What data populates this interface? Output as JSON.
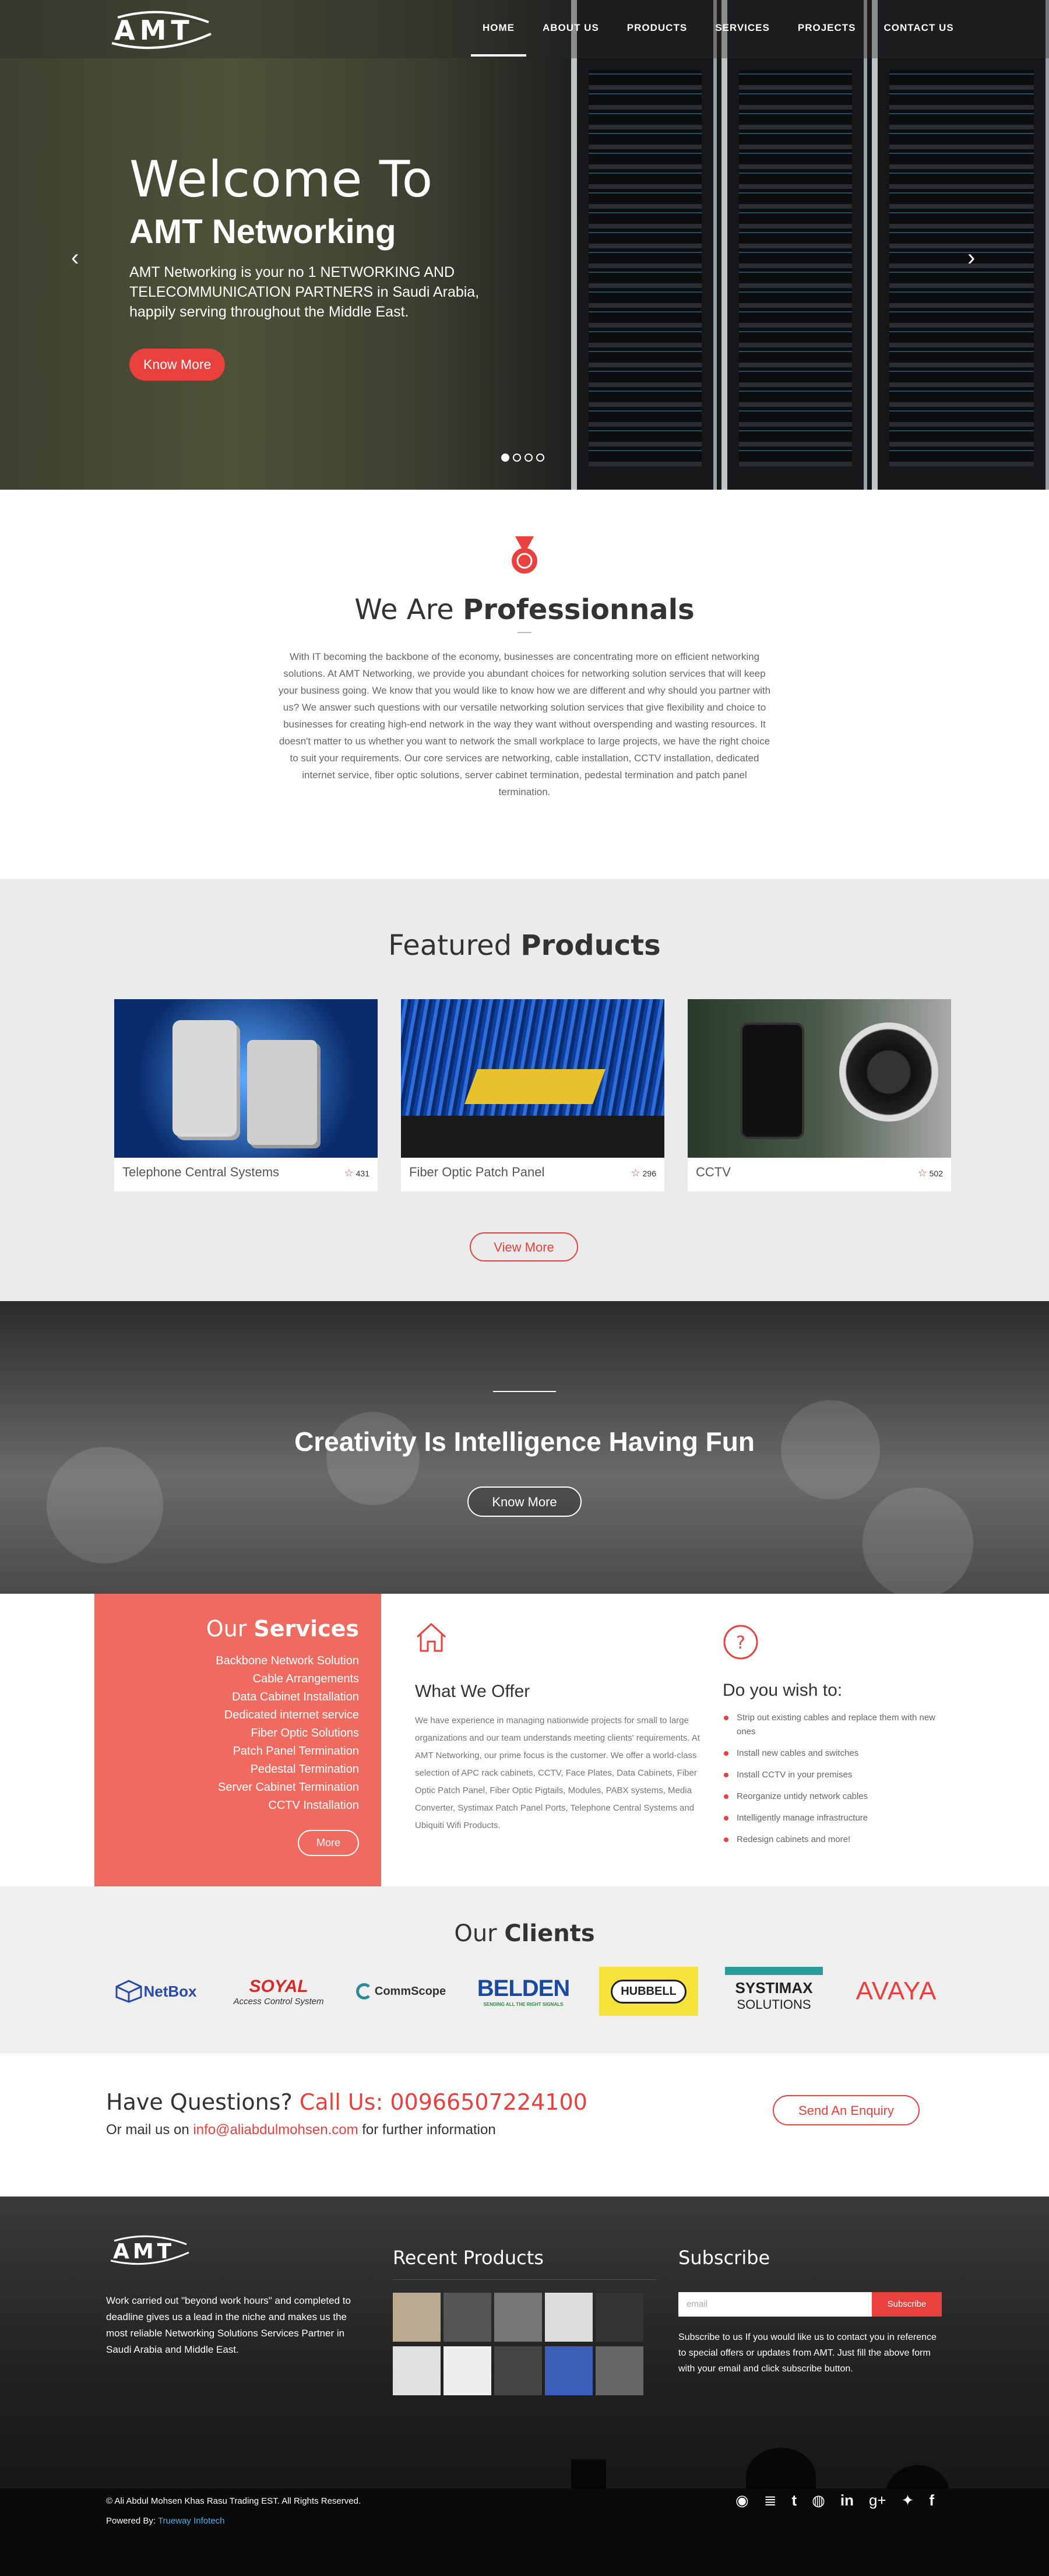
{
  "nav": {
    "logo": "AMT",
    "items": [
      "HOME",
      "ABOUT US",
      "PRODUCTS",
      "SERVICES",
      "PROJECTS",
      "CONTACT US"
    ]
  },
  "hero": {
    "line1": "Welcome To",
    "line2": "AMT Networking",
    "desc": "AMT Networking is your no 1 NETWORKING AND TELECOMMUNICATION PARTNERS in Saudi Arabia, happily serving throughout the Middle East.",
    "button": "Know More",
    "prev": "‹",
    "next": "›"
  },
  "about": {
    "title_light": "We Are ",
    "title_bold": "Professionnals",
    "text": "With IT becoming the backbone of the economy, businesses are concentrating more on efficient networking solutions. At AMT Networking, we provide you abundant choices for networking solution services that will keep your business going. We know that you would like to know how we are different and why should you partner with us? We answer such questions with our versatile networking solution services that give flexibility and choice to businesses for creating high-end network in the way they want without overspending and wasting resources. It doesn't matter to us whether you want to network the small workplace to large projects, we have the right choice to suit your requirements. Our core services are networking, cable installation, CCTV installation, dedicated internet service, fiber optic solutions, server cabinet termination, pedestal termination and patch panel termination."
  },
  "products": {
    "title_light": "Featured ",
    "title_bold": "Products",
    "items": [
      {
        "name": "Telephone Central Systems",
        "count": "431"
      },
      {
        "name": "Fiber Optic Patch Panel",
        "count": "296"
      },
      {
        "name": "CCTV",
        "count": "502"
      }
    ],
    "button": "View More"
  },
  "creativity": {
    "title": "Creativity Is Intelligence Having Fun",
    "button": "Know More"
  },
  "services": {
    "title_light": "Our ",
    "title_bold": "Services",
    "list": [
      "Backbone Network Solution",
      "Cable Arrangements",
      "Data Cabinet Installation",
      "Dedicated internet service",
      "Fiber Optic Solutions",
      "Patch Panel Termination",
      "Pedestal Termination",
      "Server Cabinet Termination",
      "CCTV Installation"
    ],
    "more": "More",
    "offer_title": "What We Offer",
    "offer_text": "We have experience in managing nationwide projects for small to large organizations and our team understands meeting clients' requirements. At AMT Networking, our prime focus is the customer. We offer a world-class selection of APC rack cabinets, CCTV, Face Plates, Data Cabinets, Fiber Optic Patch Panel, Fiber Optic Pigtails, Modules, PABX systems, Media Converter, Systimax Patch Panel Ports, Telephone Central Systems and Ubiquiti Wifi Products.",
    "wish_title": "Do you wish to:",
    "wish_list": [
      "Strip out existing cables and replace them with new ones",
      "Install new cables and switches",
      "Install CCTV in your premises",
      "Reorganize untidy network cables",
      "Intelligently manage infrastructure",
      "Redesign cabinets and more!"
    ]
  },
  "clients": {
    "title_light": "Our ",
    "title_bold": "Clients",
    "logos": [
      {
        "name": "NetBox"
      },
      {
        "name": "SOYAL",
        "sub": "Access Control System"
      },
      {
        "name": "CommScope"
      },
      {
        "name": "BELDEN",
        "sub": "SENDING ALL THE RIGHT SIGNALS"
      },
      {
        "name": "HUBBELL"
      },
      {
        "name": "SYSTIMAX",
        "sub": "SOLUTIONS"
      },
      {
        "name": "AVAYA"
      }
    ]
  },
  "contact": {
    "q_prefix": "Have Questions? ",
    "q_call": "Call Us: 00966507224100",
    "mail_prefix": "Or mail us on ",
    "mail": "info@aliabdulmohsen.com",
    "mail_suffix": " for further information",
    "button": "Send An Enquiry"
  },
  "footer": {
    "logo": "AMT",
    "about": "Work carried out \"beyond work hours\" and completed to deadline gives us a lead in the niche and makes us the most reliable Networking Solutions Services Partner in Saudi Arabia and Middle East.",
    "recent_title": "Recent Products",
    "subscribe_title": "Subscribe",
    "email_placeholder": "email",
    "subscribe_button": "Subscribe",
    "subscribe_text": "Subscribe to us If you would like us to contact you in reference to special offers or updates from AMT. Just fill the above form with your email and click subscribe button.",
    "copyright": "© Ali Abdul Mohsen Khas Rasu Trading EST. All Rights Reserved.",
    "powered_prefix": "Powered By: ",
    "powered_link": "Trueway Infotech",
    "social": [
      "github-icon",
      "stackexchange-icon",
      "tumblr-icon",
      "dribbble-icon",
      "linkedin-icon",
      "google-plus-icon",
      "twitter-icon",
      "facebook-icon"
    ]
  },
  "colors": {
    "accent": "#e8413e",
    "services_bg": "#ef6b60"
  }
}
